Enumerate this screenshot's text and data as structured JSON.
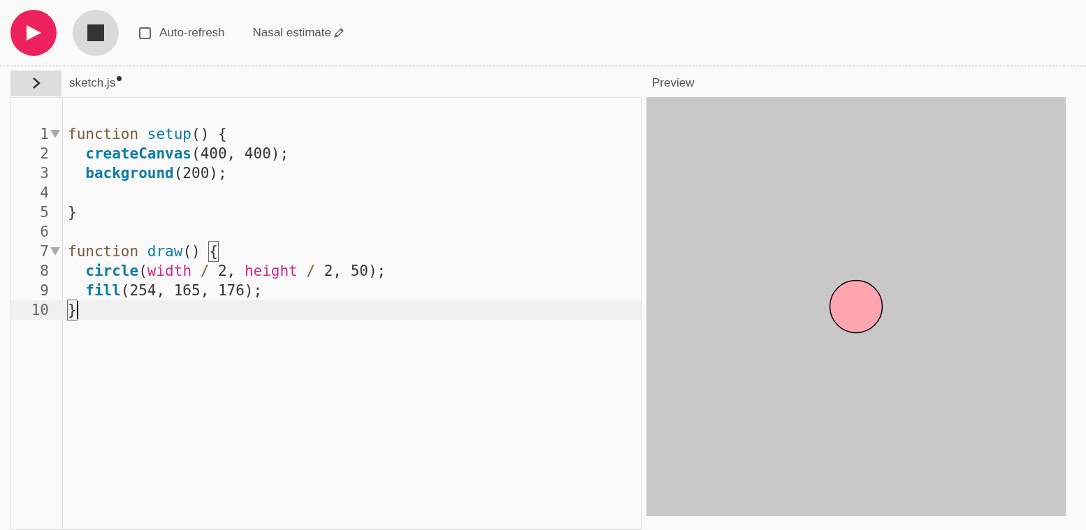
{
  "toolbar": {
    "auto_refresh": {
      "label": "Auto-refresh",
      "checked": false
    },
    "sketch_name": "Nasal estimate"
  },
  "editor": {
    "tab": {
      "filename": "sketch.js",
      "unsaved": true
    },
    "lines": [
      {
        "number": "1",
        "foldable": true,
        "active": false,
        "cursor": false,
        "tokens": [
          {
            "text": "function ",
            "kind": "keyword"
          },
          {
            "text": "setup",
            "kind": "def"
          },
          {
            "text": "() {",
            "kind": "plain"
          }
        ]
      },
      {
        "number": "2",
        "foldable": false,
        "active": false,
        "cursor": false,
        "tokens": [
          {
            "text": "  createCanvas",
            "kind": "builtin"
          },
          {
            "text": "(400, 400);",
            "kind": "plain"
          }
        ]
      },
      {
        "number": "3",
        "foldable": false,
        "active": false,
        "cursor": false,
        "tokens": [
          {
            "text": "  background",
            "kind": "builtin"
          },
          {
            "text": "(200);",
            "kind": "plain"
          }
        ]
      },
      {
        "number": "4",
        "foldable": false,
        "active": false,
        "cursor": false
      },
      {
        "number": "5",
        "foldable": false,
        "active": false,
        "cursor": false,
        "tokens": [
          {
            "text": "}",
            "kind": "plain"
          }
        ]
      },
      {
        "number": "6",
        "foldable": false,
        "active": false,
        "cursor": false
      },
      {
        "number": "7",
        "foldable": true,
        "active": false,
        "cursor": false,
        "tokens": [
          {
            "text": "function ",
            "kind": "keyword"
          },
          {
            "text": "draw",
            "kind": "def"
          },
          {
            "text": "() ",
            "kind": "plain"
          },
          {
            "text": "{",
            "kind": "bracket"
          }
        ]
      },
      {
        "number": "8",
        "foldable": false,
        "active": false,
        "cursor": false,
        "tokens": [
          {
            "text": "  circle",
            "kind": "builtin"
          },
          {
            "text": "(",
            "kind": "plain"
          },
          {
            "text": "width",
            "kind": "variable"
          },
          {
            "text": " / ",
            "kind": "operator"
          },
          {
            "text": "2, ",
            "kind": "plain"
          },
          {
            "text": "height",
            "kind": "variable"
          },
          {
            "text": " / ",
            "kind": "operator"
          },
          {
            "text": "2, 50);",
            "kind": "plain"
          }
        ]
      },
      {
        "number": "9",
        "foldable": false,
        "active": false,
        "cursor": false,
        "tokens": [
          {
            "text": "  fill",
            "kind": "builtin"
          },
          {
            "text": "(254, 165, 176);",
            "kind": "plain"
          }
        ]
      },
      {
        "number": "10",
        "foldable": false,
        "active": true,
        "cursor": true,
        "tokens": [
          {
            "text": "}",
            "kind": "bracket"
          }
        ]
      }
    ]
  },
  "preview": {
    "title": "Preview"
  }
}
